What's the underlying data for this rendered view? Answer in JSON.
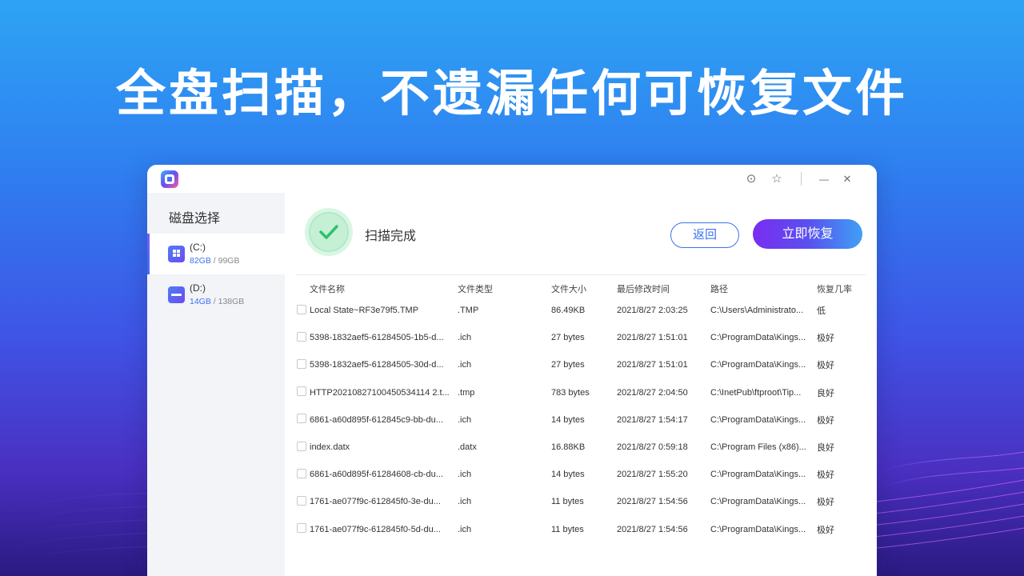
{
  "headline": "全盘扫描，不遗漏任何可恢复文件",
  "titlebar": {
    "buttons": [
      {
        "name": "feedback-icon",
        "glyph": "⊙"
      },
      {
        "name": "star-icon",
        "glyph": "☆"
      },
      {
        "name": "minimize-icon",
        "glyph": "—"
      },
      {
        "name": "close-icon",
        "glyph": "✕"
      }
    ]
  },
  "sidebar": {
    "title": "磁盘选择",
    "drives": [
      {
        "name": "(C:)",
        "used": "82GB",
        "sep": " / ",
        "total": "99GB",
        "icon": "windows-drive-icon"
      },
      {
        "name": "(D:)",
        "used": "14GB",
        "sep": " / ",
        "total": "138GB",
        "icon": "drive-icon"
      }
    ]
  },
  "main": {
    "status": "扫描完成",
    "back_label": "返回",
    "recover_label": "立即恢复",
    "columns": [
      "文件名称",
      "文件类型",
      "文件大小",
      "最后修改时间",
      "路径",
      "恢复几率"
    ],
    "rows": [
      [
        "Local State~RF3e79f5.TMP",
        ".TMP",
        "86.49KB",
        "2021/8/27 2:03:25",
        "C:\\Users\\Administrato...",
        "低"
      ],
      [
        "5398-1832aef5-61284505-1b5-d...",
        ".ich",
        "27 bytes",
        "2021/8/27 1:51:01",
        "C:\\ProgramData\\Kings...",
        "极好"
      ],
      [
        "5398-1832aef5-61284505-30d-d...",
        ".ich",
        "27 bytes",
        "2021/8/27 1:51:01",
        "C:\\ProgramData\\Kings...",
        "极好"
      ],
      [
        "HTTP20210827100450534114 2.t...",
        ".tmp",
        "783 bytes",
        "2021/8/27 2:04:50",
        "C:\\InetPub\\ftproot\\Tip...",
        "良好"
      ],
      [
        "6861-a60d895f-612845c9-bb-du...",
        ".ich",
        "14 bytes",
        "2021/8/27 1:54:17",
        "C:\\ProgramData\\Kings...",
        "极好"
      ],
      [
        "index.datx",
        ".datx",
        "16.88KB",
        "2021/8/27 0:59:18",
        "C:\\Program Files (x86)...",
        "良好"
      ],
      [
        "6861-a60d895f-61284608-cb-du...",
        ".ich",
        "14 bytes",
        "2021/8/27 1:55:20",
        "C:\\ProgramData\\Kings...",
        "极好"
      ],
      [
        "1761-ae077f9c-612845f0-3e-du...",
        ".ich",
        "11 bytes",
        "2021/8/27 1:54:56",
        "C:\\ProgramData\\Kings...",
        "极好"
      ],
      [
        "1761-ae077f9c-612845f0-5d-du...",
        ".ich",
        "11 bytes",
        "2021/8/27 1:54:56",
        "C:\\ProgramData\\Kings...",
        "极好"
      ]
    ]
  },
  "colors": {
    "accent": "#3c72f0",
    "success": "#2bc36b",
    "recover_gradient_start": "#7a2df0",
    "recover_gradient_end": "#3fa0f5"
  }
}
